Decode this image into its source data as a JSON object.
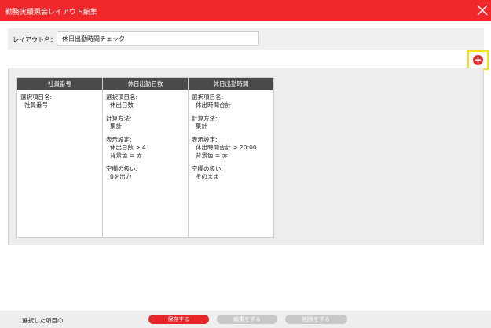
{
  "window": {
    "title": "勤務実績照会レイアウト編集",
    "colors": {
      "titlebar": "#f0282c",
      "accent": "#e8262a",
      "highlight": "#f5e017"
    }
  },
  "layout_name": {
    "label": "レイアウト名：",
    "value": "休日出勤時間チェック"
  },
  "add_button": {
    "icon": "plus-circle-icon",
    "symbol": "+"
  },
  "columns": [
    {
      "header": "社員番号",
      "item_label": "選択項目名:",
      "item_value": "社員番号"
    },
    {
      "header": "休日出勤日数",
      "item_label": "選択項目名:",
      "item_value": "休出日数",
      "calc_label": "計算方法:",
      "calc_value": "集計",
      "display_label": "表示設定:",
      "display_condition": "休出日数 > 4",
      "display_color": "背景色 = 赤",
      "empty_label": "空欄の扱い:",
      "empty_value": "0を出力"
    },
    {
      "header": "休日出勤時間",
      "item_label": "選択項目名:",
      "item_value": "休出時間合計",
      "calc_label": "計算方法:",
      "calc_value": "集計",
      "display_label": "表示設定:",
      "display_condition": "休出時間合計 > 20:00",
      "display_color": "背景色 = 赤",
      "empty_label": "空欄の扱い:",
      "empty_value": "そのまま"
    }
  ],
  "footer": {
    "caption": "選択した項目の",
    "save_label": "保存する",
    "edit_label": "編集をする",
    "delete_label": "削除をする"
  }
}
